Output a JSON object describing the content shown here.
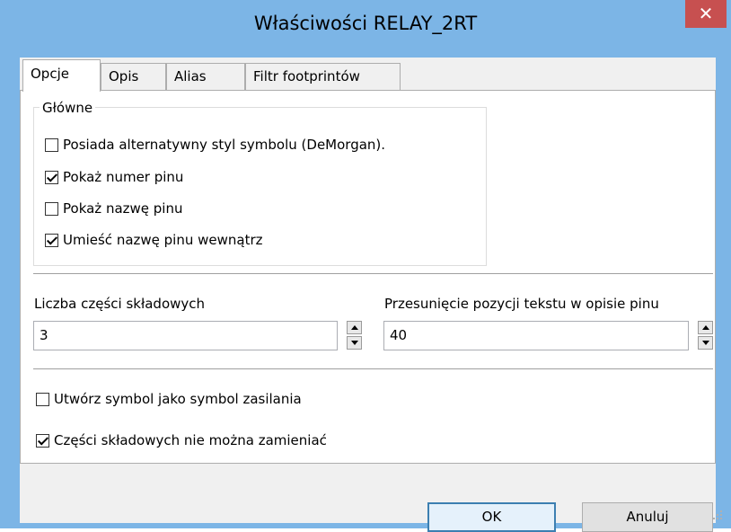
{
  "window": {
    "title": "Właściwości RELAY_2RT",
    "close_label": "✕"
  },
  "tabs": [
    {
      "label": "Opcje",
      "active": true
    },
    {
      "label": "Opis",
      "active": false
    },
    {
      "label": "Alias",
      "active": false
    },
    {
      "label": "Filtr footprintów",
      "active": false
    }
  ],
  "general": {
    "title": "Główne",
    "options": [
      {
        "label": "Posiada alternatywny styl symbolu (DeMorgan).",
        "checked": false
      },
      {
        "label": "Pokaż numer pinu",
        "checked": true
      },
      {
        "label": "Pokaż nazwę pinu",
        "checked": false
      },
      {
        "label": "Umieść nazwę pinu wewnątrz",
        "checked": true
      }
    ]
  },
  "parts": {
    "label": "Liczba części składowych",
    "value": "3"
  },
  "pin_offset": {
    "label": "Przesunięcie pozycji tekstu w opisie pinu",
    "value": "40"
  },
  "power_symbol": {
    "label": "Utwórz symbol jako symbol zasilania",
    "checked": false
  },
  "parts_not_interchangeable": {
    "label": "Części składowych nie można zamieniać",
    "checked": true
  },
  "buttons": {
    "ok": "OK",
    "cancel": "Anuluj"
  },
  "colors": {
    "frame": "#7cb5e6",
    "close": "#c75050",
    "panel": "#ffffff",
    "dialog": "#f0f0f0"
  }
}
